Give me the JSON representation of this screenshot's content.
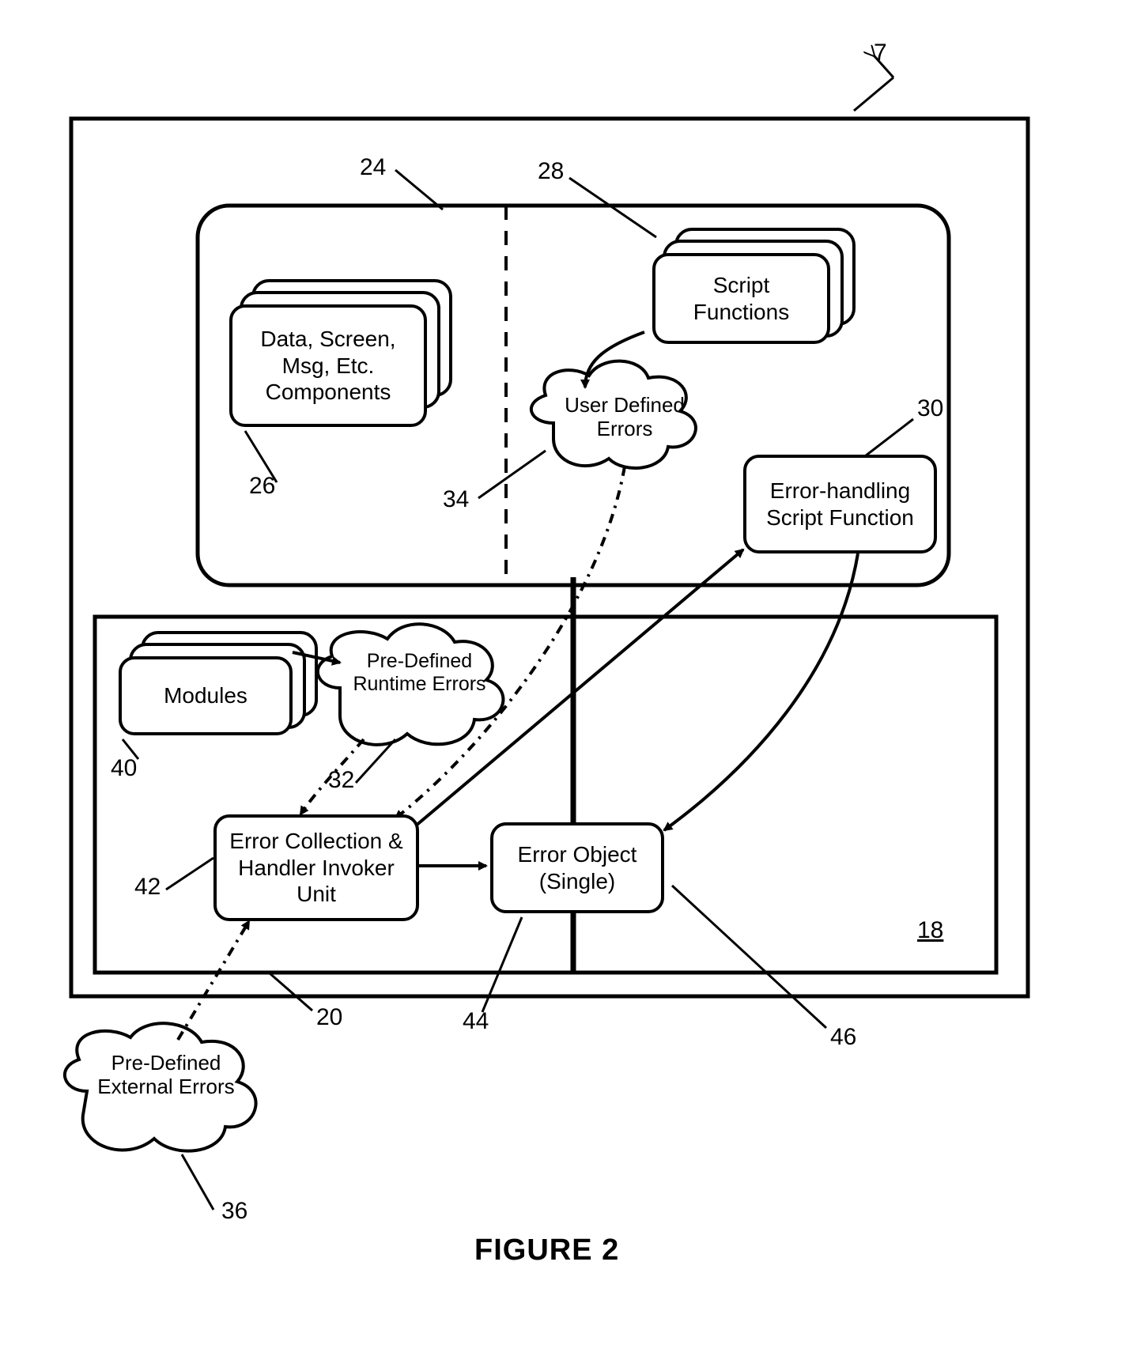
{
  "refs": {
    "r7": "7",
    "r24": "24",
    "r28": "28",
    "r26": "26",
    "r34": "34",
    "r30": "30",
    "r40": "40",
    "r32": "32",
    "r42": "42",
    "r18": "18",
    "r20": "20",
    "r44": "44",
    "r46": "46",
    "r36": "36"
  },
  "boxes": {
    "components": "Data, Screen, Msg, Etc. Components",
    "script_functions": "Script Functions",
    "user_defined_errors": "User Defined Errors",
    "error_handling_script": "Error-handling Script Function",
    "modules": "Modules",
    "predefined_runtime_errors": "Pre-Defined Runtime Errors",
    "error_collection_invoker": "Error Collection & Handler Invoker Unit",
    "error_object_single": "Error Object (Single)",
    "predefined_external_errors": "Pre-Defined External Errors"
  },
  "figure_title": "FIGURE 2"
}
